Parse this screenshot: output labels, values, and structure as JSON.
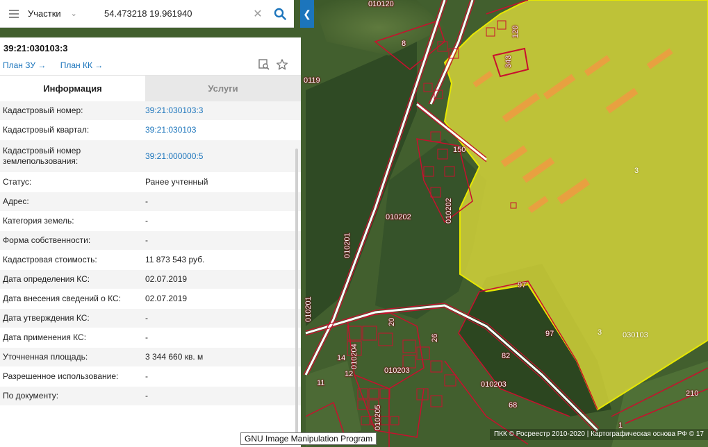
{
  "search": {
    "layer": "Участки",
    "query": "54.473218 19.961940"
  },
  "object": {
    "id": "39:21:030103:3",
    "plan_zu": "План ЗУ →",
    "plan_kk": "План КК →"
  },
  "tabs": {
    "info": "Информация",
    "services": "Услуги"
  },
  "rows": [
    {
      "label": "Кадастровый номер:",
      "value": "39:21:030103:3",
      "link": true
    },
    {
      "label": "Кадастровый квартал:",
      "value": "39:21:030103",
      "link": true
    },
    {
      "label": "Кадастровый номер землепользования:",
      "value": "39:21:000000:5",
      "link": true
    },
    {
      "label": "Статус:",
      "value": "Ранее учтенный",
      "link": false
    },
    {
      "label": "Адрес:",
      "value": "-",
      "link": false
    },
    {
      "label": "Категория земель:",
      "value": "-",
      "link": false
    },
    {
      "label": "Форма собственности:",
      "value": "-",
      "link": false
    },
    {
      "label": "Кадастровая стоимость:",
      "value": "11 873 543 руб.",
      "link": false
    },
    {
      "label": "Дата определения КС:",
      "value": "02.07.2019",
      "link": false
    },
    {
      "label": "Дата внесения сведений о КС:",
      "value": "02.07.2019",
      "link": false
    },
    {
      "label": "Дата утверждения КС:",
      "value": "-",
      "link": false
    },
    {
      "label": "Дата применения КС:",
      "value": "-",
      "link": false
    },
    {
      "label": "Уточненная площадь:",
      "value": "3 344 660 кв. м",
      "link": false
    },
    {
      "label": "Разрешенное использование:",
      "value": "-",
      "link": false
    },
    {
      "label": "По документу:",
      "value": "-",
      "link": false
    }
  ],
  "map": {
    "labels": {
      "q010120": "010120",
      "q010119": "0119",
      "q010202": "010202",
      "q010202v": "010202",
      "q010201": "010201",
      "q010201b": "010201",
      "q010204": "010204",
      "q010203": "010203",
      "q010203b": "010203",
      "q010205": "010205",
      "q030103": "030103",
      "p8": "8",
      "p120": "120",
      "p343": "343",
      "p150": "150",
      "p3a": "3",
      "p3b": "3",
      "p97a": "97",
      "p97b": "97",
      "p82": "82",
      "p68": "68",
      "p210": "210",
      "p20": "20",
      "p26": "26",
      "p14": "14",
      "p12": "12",
      "p11": "11",
      "p1": "1"
    },
    "attribution": "ПКК © Росреестр 2010-2020 | Картографическая основа РФ © 17"
  },
  "tooltip": "GNU Image Manipulation Program",
  "colors": {
    "accent": "#1c75bc",
    "parcel_fill": "#e8e84a",
    "boundary": "#c8102e"
  }
}
